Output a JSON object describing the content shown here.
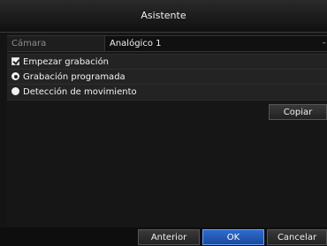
{
  "window": {
    "title": "Asistente"
  },
  "camera": {
    "label": "Cámara",
    "selected": "Analógico 1"
  },
  "options": {
    "start_recording": {
      "label": "Empezar grabación",
      "checked": true
    },
    "scheduled_recording": {
      "label": "Grabación programada",
      "selected": true
    },
    "motion_detection": {
      "label": "Detección de movimiento",
      "selected": false
    }
  },
  "buttons": {
    "copy": "Copiar",
    "previous": "Anterior",
    "ok": "OK",
    "cancel": "Cancelar"
  },
  "colors": {
    "accent": "#2e6bd0",
    "background": "#141414"
  }
}
